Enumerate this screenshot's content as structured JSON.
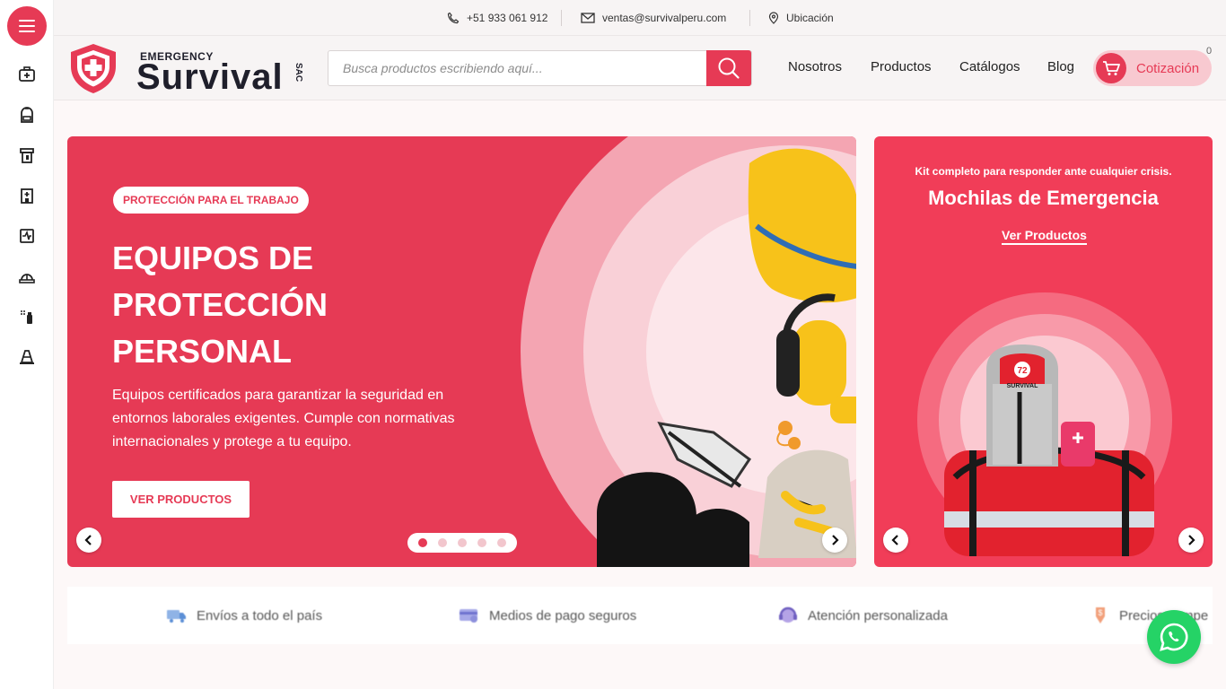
{
  "topbar": {
    "phone": "+51 933 061 912",
    "email": "ventas@survivalperu.com",
    "location": "Ubicación"
  },
  "logo": {
    "small": "EMERGENCY",
    "big": "Survival",
    "suffix": "SAC"
  },
  "search": {
    "placeholder": "Busca productos escribiendo aquí..."
  },
  "nav": {
    "items": [
      "Nosotros",
      "Productos",
      "Catálogos",
      "Blog"
    ],
    "quote_label": "Cotización",
    "quote_count": "0"
  },
  "sidebar": {
    "icons": [
      "first-aid-kit-icon",
      "backpack-icon",
      "extinguisher-cabinet-icon",
      "hospital-icon",
      "monitor-pulse-icon",
      "hard-hat-icon",
      "spray-icon",
      "traffic-cone-icon"
    ]
  },
  "hero": {
    "tag": "PROTECCIÓN PARA EL TRABAJO",
    "title_lines": [
      "EQUIPOS DE",
      "PROTECCIÓN",
      "PERSONAL"
    ],
    "description": "Equipos certificados para garantizar la seguridad en entornos laborales exigentes. Cumple con normativas internacionales y protege a tu equipo.",
    "cta": "VER PRODUCTOS",
    "slides_count": 5,
    "active_slide": 1
  },
  "side_banner": {
    "subtitle": "Kit completo para responder ante cualquier crisis.",
    "title": "Mochilas de Emergencia",
    "link": "Ver Productos",
    "backpack_badge": "72",
    "backpack_brand": "SURVIVAL"
  },
  "features": [
    {
      "label": "Envíos a todo el país",
      "icon": "truck-icon"
    },
    {
      "label": "Medios de pago seguros",
      "icon": "credit-card-icon"
    },
    {
      "label": "Atención personalizada",
      "icon": "headset-icon"
    },
    {
      "label": "Precios compe",
      "icon": "price-tag-icon"
    }
  ],
  "colors": {
    "brand": "#e63a55",
    "brand_light": "#f8c9d0",
    "whatsapp": "#25d366"
  }
}
